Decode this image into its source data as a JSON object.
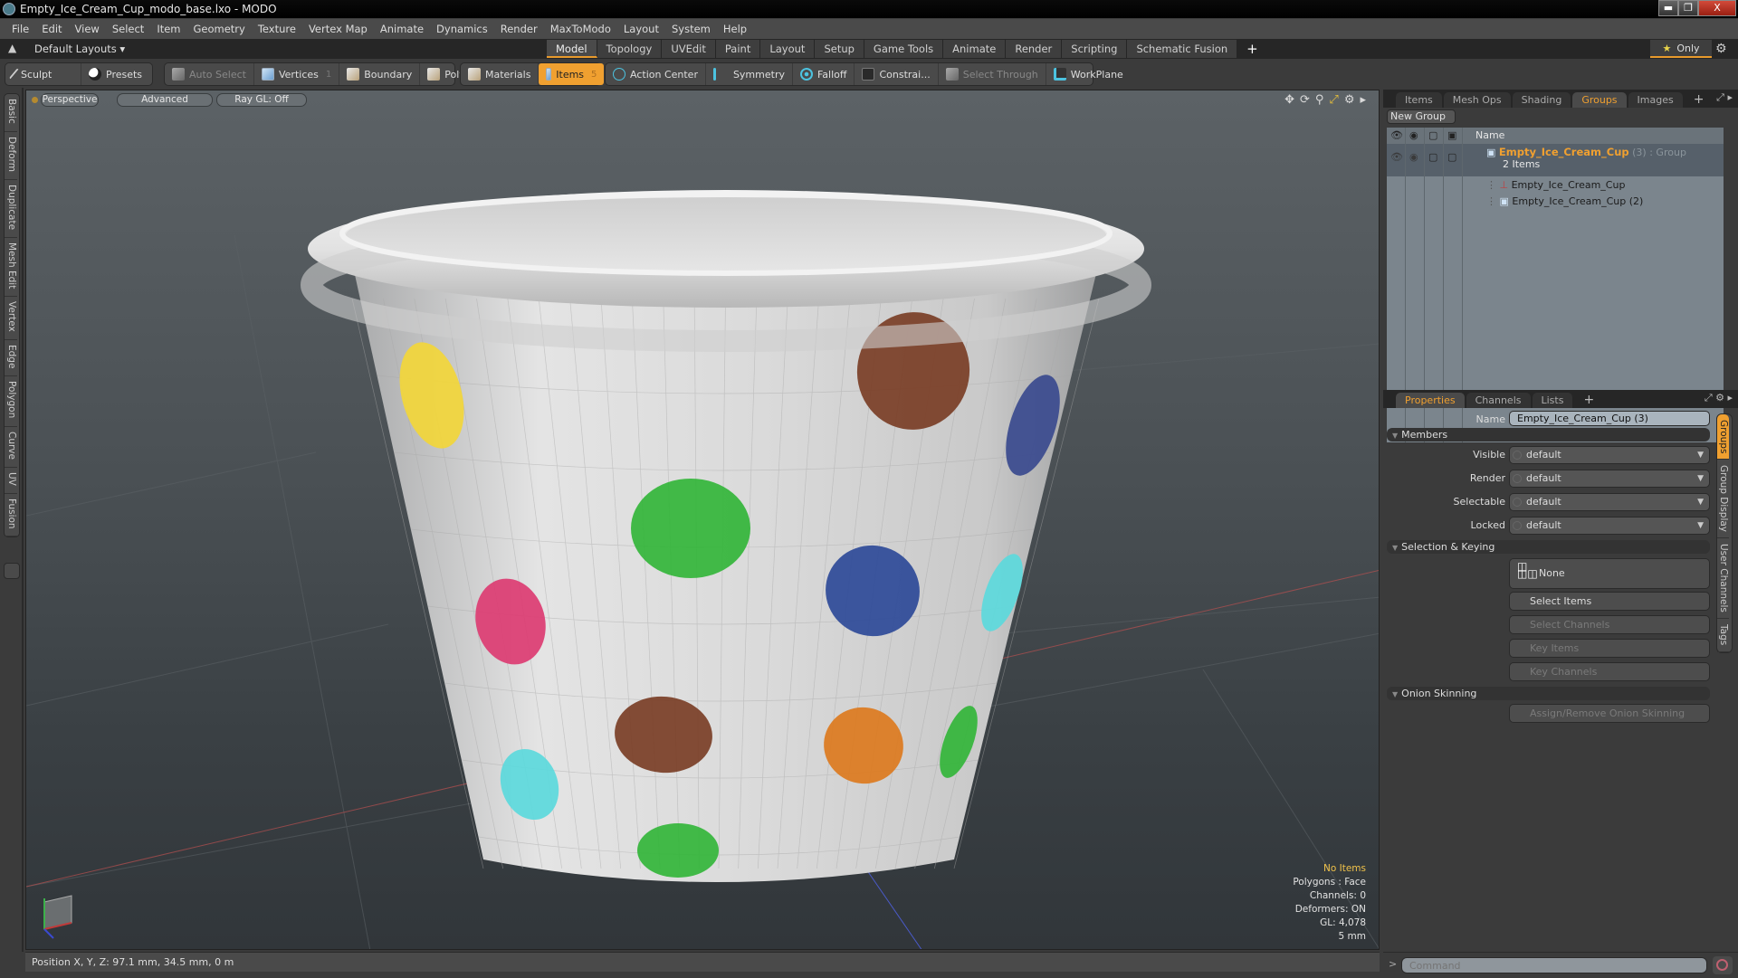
{
  "window": {
    "title": "Empty_Ice_Cream_Cup_modo_base.lxo - MODO",
    "controls": [
      "minimize",
      "restore",
      "close"
    ]
  },
  "menubar": [
    "File",
    "Edit",
    "View",
    "Select",
    "Item",
    "Geometry",
    "Texture",
    "Vertex Map",
    "Animate",
    "Dynamics",
    "Render",
    "MaxToModo",
    "Layout",
    "System",
    "Help"
  ],
  "layoutbar": {
    "layouts_label": "Default Layouts",
    "tabs": [
      "Model",
      "Topology",
      "UVEdit",
      "Paint",
      "Layout",
      "Setup",
      "Game Tools",
      "Animate",
      "Render",
      "Scripting",
      "Schematic Fusion"
    ],
    "active_tab": "Model",
    "add_tab": "+",
    "only_label": "Only"
  },
  "toolbar": {
    "sculpt": "Sculpt",
    "presets": "Presets",
    "auto_select": "Auto Select",
    "vertices": "Vertices",
    "vertices_count": "1",
    "boundary": "Boundary",
    "polygons": "Polygons",
    "materials": "Materials",
    "items": "Items",
    "items_count": "5",
    "action_center": "Action Center",
    "symmetry": "Symmetry",
    "falloff": "Falloff",
    "constraints": "Constrai...",
    "select_through": "Select Through",
    "workplane": "WorkPlane"
  },
  "left_tabs": [
    "Basic",
    "Deform",
    "Duplicate",
    "Mesh Edit",
    "Vertex",
    "Edge",
    "Polygon",
    "Curve",
    "UV",
    "Fusion"
  ],
  "viewport": {
    "view_mode": "Perspective",
    "shading": "Advanced",
    "raygl": "Ray GL: Off",
    "info": {
      "selection": "No Items",
      "polygons": "Polygons : Face",
      "channels": "Channels: 0",
      "deformers": "Deformers: ON",
      "gl": "GL: 4,078",
      "grid": "5 mm"
    },
    "dot_colors": {
      "yellow": "#f2d63a",
      "brown": "#7a3e26",
      "navy": "#3a4a8e",
      "green": "#33b53a",
      "blue": "#2e4a98",
      "pink": "#dc3c72",
      "cyan": "#5cd9dc",
      "orange": "#dc7a1e"
    }
  },
  "statusbar": {
    "position": "Position X, Y, Z:   97.1 mm, 34.5 mm, 0 m"
  },
  "groups_panel": {
    "tabs": [
      "Items",
      "Mesh Ops",
      "Shading",
      "Groups",
      "Images"
    ],
    "active_tab": "Groups",
    "new_group": "New Group",
    "name_header": "Name",
    "group": {
      "name": "Empty_Ice_Cream_Cup",
      "suffix": "(3)",
      "type": ": Group",
      "count": "2 Items"
    },
    "children": [
      "Empty_Ice_Cream_Cup",
      "Empty_Ice_Cream_Cup (2)"
    ]
  },
  "properties_panel": {
    "tabs": [
      "Properties",
      "Channels",
      "Lists"
    ],
    "active_tab": "Properties",
    "name_label": "Name",
    "name_value": "Empty_Ice_Cream_Cup (3)",
    "members_header": "Members",
    "members": [
      {
        "label": "Visible",
        "value": "default"
      },
      {
        "label": "Render",
        "value": "default"
      },
      {
        "label": "Selectable",
        "value": "default"
      },
      {
        "label": "Locked",
        "value": "default"
      }
    ],
    "selection_header": "Selection & Keying",
    "none_label": "None",
    "buttons": [
      "Select Items",
      "Select Channels",
      "Key Items",
      "Key Channels"
    ],
    "onion_header": "Onion Skinning",
    "onion_button": "Assign/Remove Onion Skinning",
    "side_tabs": [
      "Groups",
      "Group Display",
      "User Channels",
      "Tags"
    ]
  },
  "command": {
    "prompt": ">",
    "placeholder": "Command"
  },
  "colors": {
    "accent": "#f0a030",
    "group_name": "#f0a030",
    "info_highlight": "#f0c24a"
  }
}
